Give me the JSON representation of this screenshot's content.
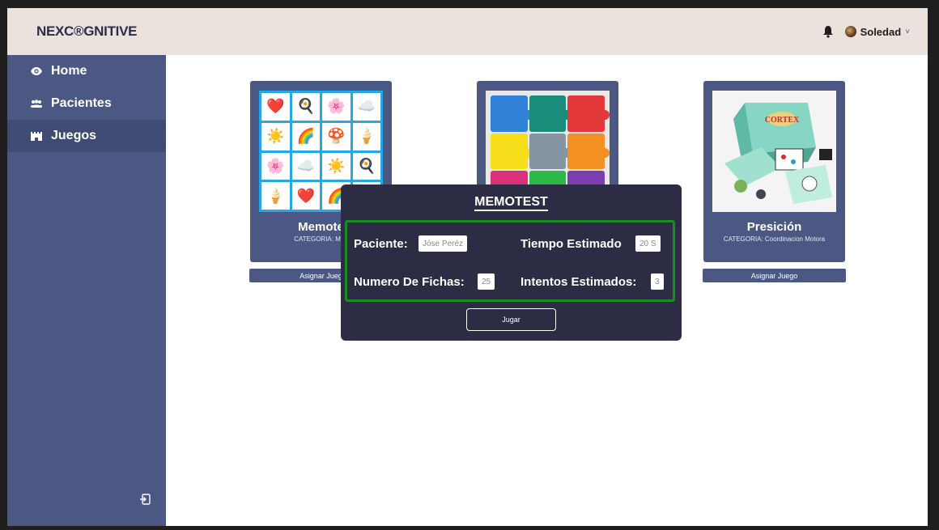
{
  "app": {
    "brand": "NEXC®GNITIVE"
  },
  "header": {
    "user_name": "Soledad",
    "caret": "˅"
  },
  "sidebar": {
    "items": [
      {
        "label": "Home",
        "icon": "eye-icon"
      },
      {
        "label": "Pacientes",
        "icon": "users-icon"
      },
      {
        "label": "Juegos",
        "icon": "castle-icon"
      }
    ]
  },
  "cards": [
    {
      "title": "Memote",
      "category": "CATEGORIA: Men",
      "assign_label": "Asignar Jueg"
    },
    {
      "title": "",
      "category": "",
      "assign_label": ""
    },
    {
      "title": "Presición",
      "category": "CATEGORIA: Coordinacion Motora",
      "assign_label": "Asignar Juego"
    }
  ],
  "memo_emojis": [
    "❤️",
    "🍳",
    "🌸",
    "☁️",
    "☀️",
    "🌈",
    "🍄",
    "🍦",
    "🌸",
    "☁️",
    "☀️",
    "🍳",
    "🍦",
    "❤️",
    "🌈",
    "🍳"
  ],
  "modal": {
    "title": "MEMOTEST",
    "fields": {
      "patient_label": "Paciente:",
      "patient_value": "Jóse Peréz",
      "time_label": "Tiempo Estimado",
      "time_value": "20 S",
      "cards_label": "Numero De Fichas:",
      "cards_value": "25",
      "attempts_label": "Intentos Estimados:",
      "attempts_value": "3"
    },
    "play_label": "Jugar"
  },
  "colors": {
    "header_bg": "#ece2dd",
    "sidebar_bg": "#4b5883",
    "sidebar_active": "#3f4b72",
    "modal_bg": "#2c2c45",
    "info_border": "#1c8a22"
  }
}
